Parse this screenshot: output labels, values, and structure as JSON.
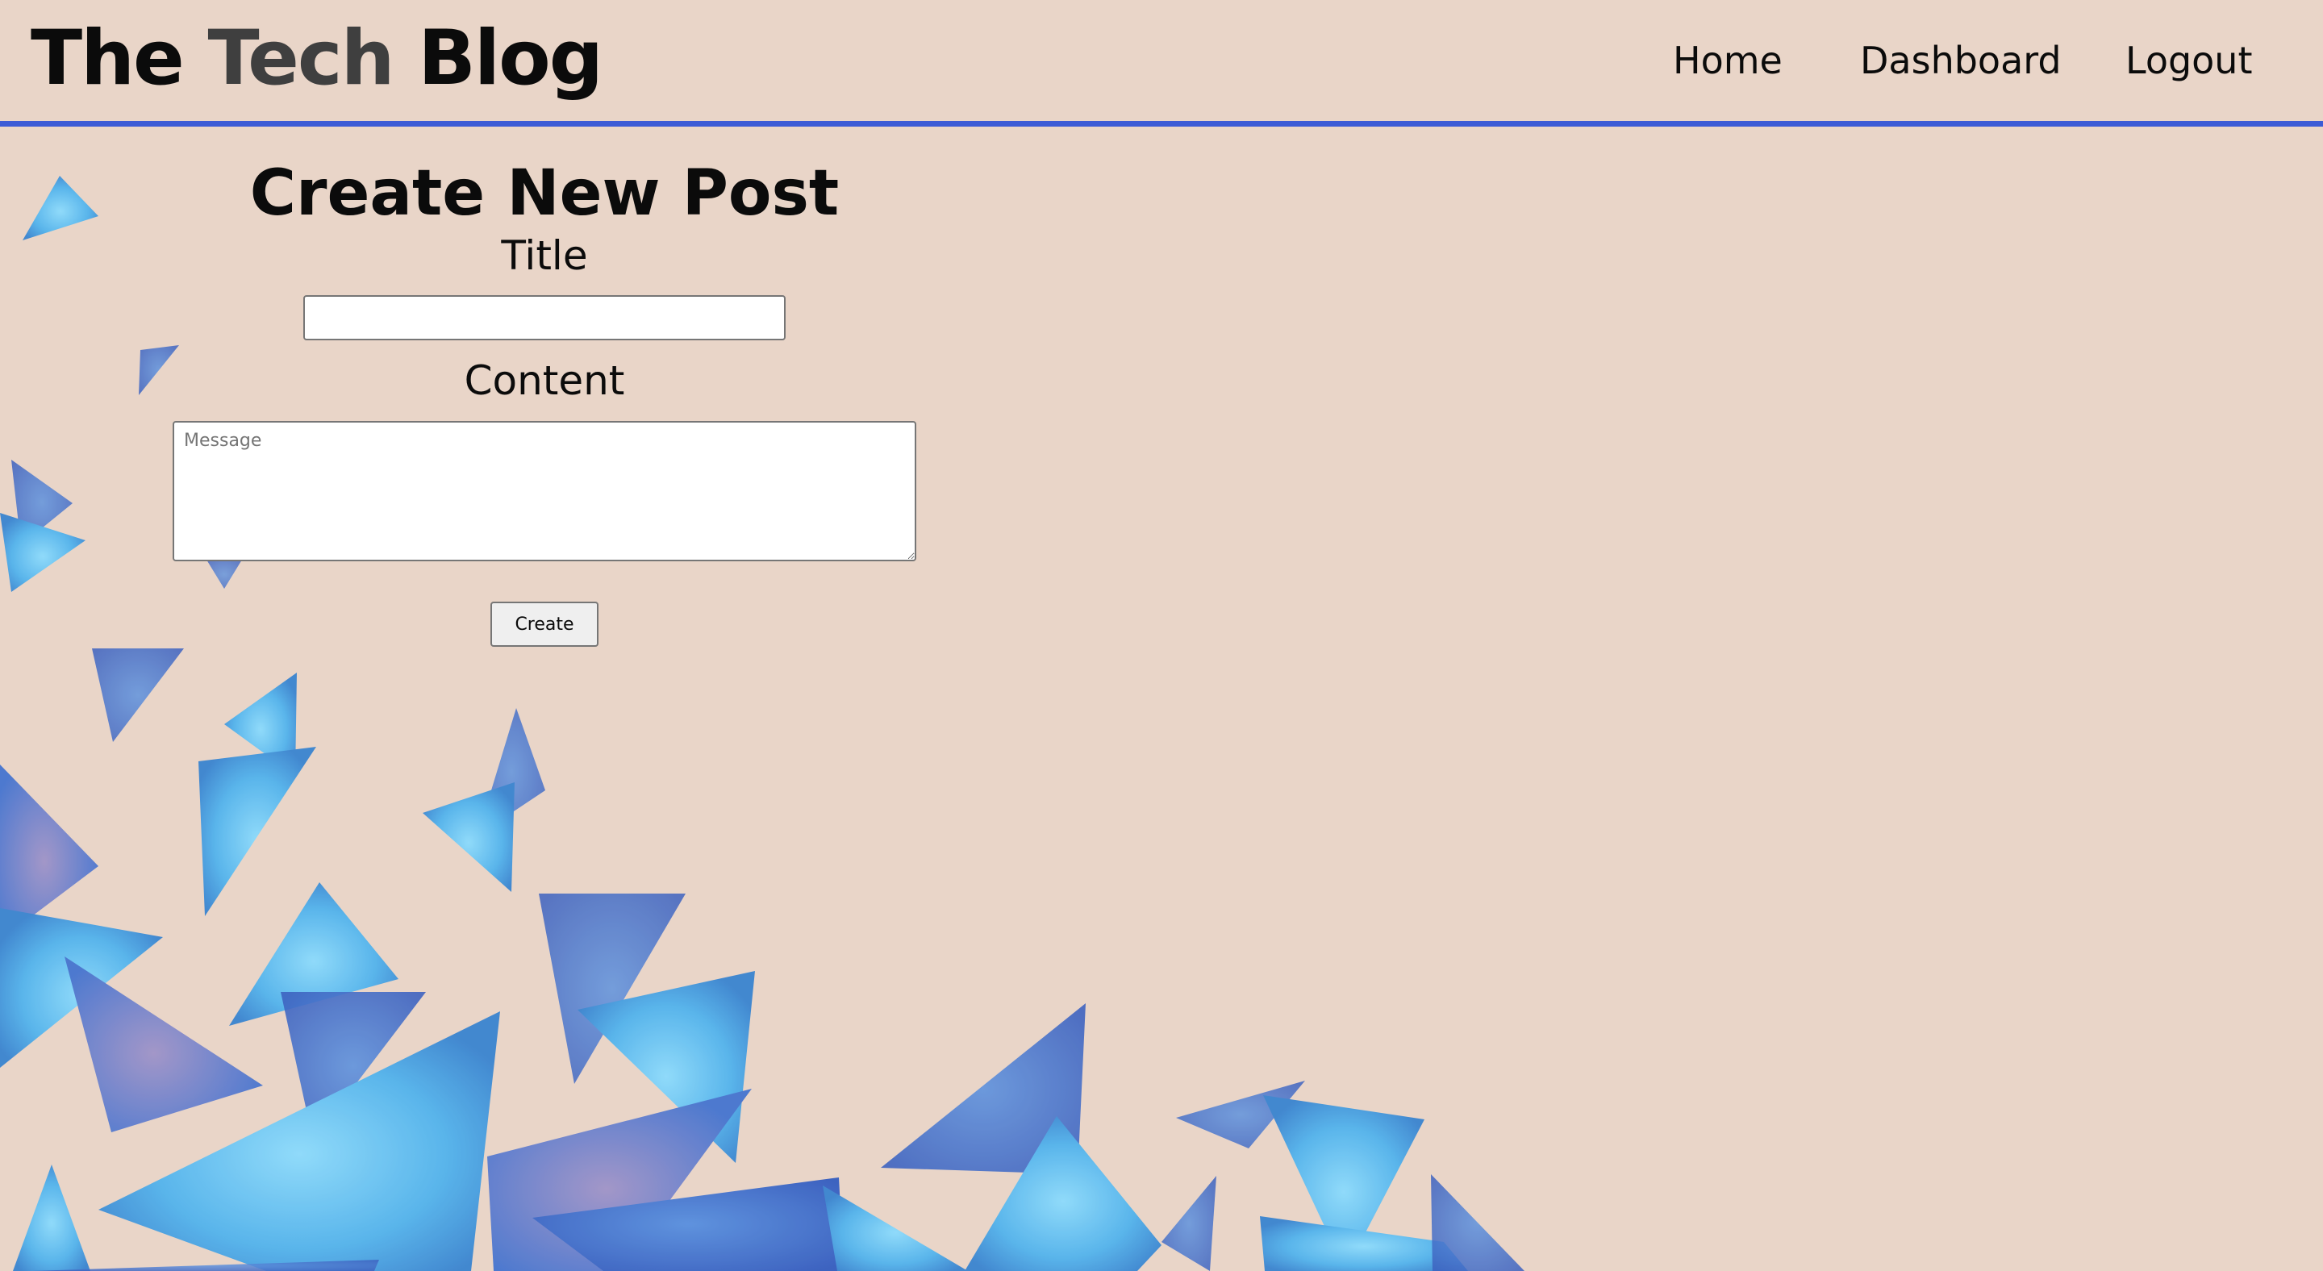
{
  "header": {
    "logo_the": "The ",
    "logo_tech": "Tech",
    "logo_blog": " Blog",
    "nav": {
      "home": "Home",
      "dashboard": "Dashboard",
      "logout": "Logout"
    }
  },
  "form": {
    "heading": "Create New Post",
    "title_label": "Title",
    "title_value": "",
    "content_label": "Content",
    "content_placeholder": "Message",
    "content_value": "",
    "submit_label": "Create"
  },
  "colors": {
    "background": "#e9d5c8",
    "accent_border": "#3c5bd6",
    "triangle_light": "#7fd3fb",
    "triangle_mid": "#3a8fd8",
    "triangle_dark": "#1f3fa6"
  }
}
